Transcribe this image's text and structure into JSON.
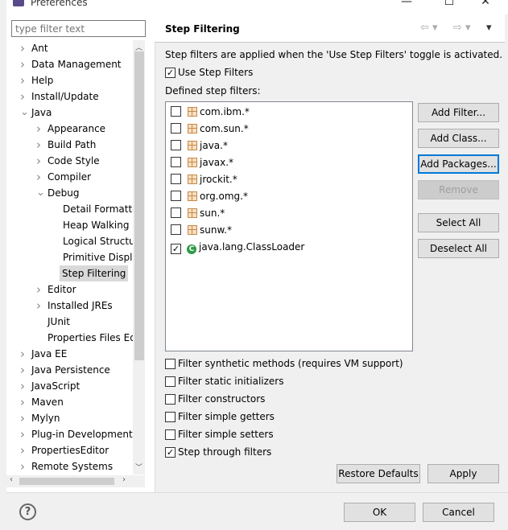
{
  "window": {
    "title": "Preferences"
  },
  "filter": {
    "placeholder": "type filter text"
  },
  "tree": [
    {
      "label": "Ant",
      "level": 0,
      "exp": ">"
    },
    {
      "label": "Data Management",
      "level": 0,
      "exp": ">"
    },
    {
      "label": "Help",
      "level": 0,
      "exp": ">"
    },
    {
      "label": "Install/Update",
      "level": 0,
      "exp": ">"
    },
    {
      "label": "Java",
      "level": 0,
      "exp": "v"
    },
    {
      "label": "Appearance",
      "level": 1,
      "exp": ">"
    },
    {
      "label": "Build Path",
      "level": 1,
      "exp": ">"
    },
    {
      "label": "Code Style",
      "level": 1,
      "exp": ">"
    },
    {
      "label": "Compiler",
      "level": 1,
      "exp": ">"
    },
    {
      "label": "Debug",
      "level": 1,
      "exp": "v"
    },
    {
      "label": "Detail Formatters",
      "level": 2,
      "exp": ""
    },
    {
      "label": "Heap Walking",
      "level": 2,
      "exp": ""
    },
    {
      "label": "Logical Structures",
      "level": 2,
      "exp": ""
    },
    {
      "label": "Primitive Display Options",
      "level": 2,
      "exp": ""
    },
    {
      "label": "Step Filtering",
      "level": 2,
      "exp": "",
      "selected": true
    },
    {
      "label": "Editor",
      "level": 1,
      "exp": ">"
    },
    {
      "label": "Installed JREs",
      "level": 1,
      "exp": ">"
    },
    {
      "label": "JUnit",
      "level": 1,
      "exp": ""
    },
    {
      "label": "Properties Files Editor",
      "level": 1,
      "exp": ""
    },
    {
      "label": "Java EE",
      "level": 0,
      "exp": ">"
    },
    {
      "label": "Java Persistence",
      "level": 0,
      "exp": ">"
    },
    {
      "label": "JavaScript",
      "level": 0,
      "exp": ">"
    },
    {
      "label": "Maven",
      "level": 0,
      "exp": ">"
    },
    {
      "label": "Mylyn",
      "level": 0,
      "exp": ">"
    },
    {
      "label": "Plug-in Development",
      "level": 0,
      "exp": ">"
    },
    {
      "label": "PropertiesEditor",
      "level": 0,
      "exp": ">"
    },
    {
      "label": "Remote Systems",
      "level": 0,
      "exp": ">"
    }
  ],
  "page": {
    "title": "Step Filtering",
    "description": "Step filters are applied when the 'Use Step Filters' toggle is activated.",
    "use_step_filters": {
      "label": "Use Step Filters",
      "checked": true
    },
    "defined_label": "Defined step filters:",
    "filters": [
      {
        "name": "com.ibm.*",
        "checked": false,
        "icon": "package"
      },
      {
        "name": "com.sun.*",
        "checked": false,
        "icon": "package"
      },
      {
        "name": "java.*",
        "checked": false,
        "icon": "package"
      },
      {
        "name": "javax.*",
        "checked": false,
        "icon": "package"
      },
      {
        "name": "jrockit.*",
        "checked": false,
        "icon": "package"
      },
      {
        "name": "org.omg.*",
        "checked": false,
        "icon": "package"
      },
      {
        "name": "sun.*",
        "checked": false,
        "icon": "package"
      },
      {
        "name": "sunw.*",
        "checked": false,
        "icon": "package"
      },
      {
        "name": "java.lang.ClassLoader",
        "checked": true,
        "icon": "class"
      }
    ],
    "buttons": {
      "add_filter": "Add Filter...",
      "add_class": "Add Class...",
      "add_packages": "Add Packages...",
      "remove": "Remove",
      "select_all": "Select All",
      "deselect_all": "Deselect All"
    },
    "options": [
      {
        "label": "Filter synthetic methods (requires VM support)",
        "checked": false
      },
      {
        "label": "Filter static initializers",
        "checked": false
      },
      {
        "label": "Filter constructors",
        "checked": false
      },
      {
        "label": "Filter simple getters",
        "checked": false
      },
      {
        "label": "Filter simple setters",
        "checked": false
      },
      {
        "label": "Step through filters",
        "checked": true
      }
    ],
    "restore_defaults": "Restore Defaults",
    "apply": "Apply"
  },
  "footer": {
    "ok": "OK",
    "cancel": "Cancel"
  }
}
